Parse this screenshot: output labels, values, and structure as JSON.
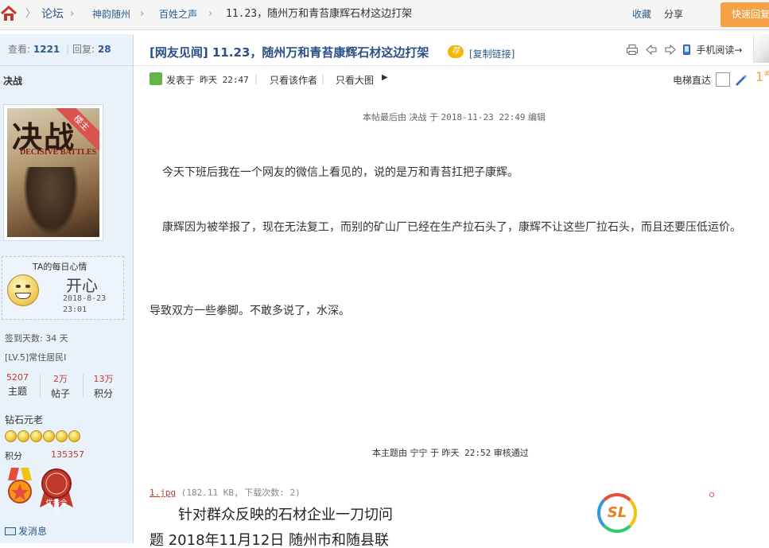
{
  "breadcrumb": {
    "items": [
      "论坛",
      "神韵随州",
      "百姓之声",
      "11.23，随州万和青苔康辉石材这边打架"
    ]
  },
  "top_actions": {
    "favorite": "收藏",
    "share": "分享",
    "quick_reply": "快速回复"
  },
  "sidebar": {
    "view_label": "查看:",
    "view_count": "1221",
    "reply_label": "回复:",
    "reply_count": "28",
    "username": "决战",
    "avatar": {
      "title": "决战",
      "subtitle": "DECISIVE BATTLES",
      "ribbon": "楼主"
    },
    "mood": {
      "label": "TA的每日心情",
      "text": "开心",
      "time": "2018-8-23 23:01"
    },
    "checkin": "签到天数: 34 天",
    "level": "[LV.5]常住居民I",
    "stats": [
      {
        "value": "5207",
        "label": "主题"
      },
      {
        "value": "2万",
        "label": "帖子"
      },
      {
        "value": "13万",
        "label": "积分"
      }
    ],
    "rank": "钻石元老",
    "points_label": "积分",
    "points_value": "135357",
    "medal_text": "优秀会员",
    "send_message": "发消息"
  },
  "post": {
    "title": "[网友见闻] 11.23，随州万和青苔康辉石材这边打架",
    "badge": "荐",
    "copy_link": "[复制链接]",
    "mobile_read": "手机阅读",
    "posted_on": "发表于",
    "posted_time": "昨天 22:47",
    "author_only": "只看该作者",
    "large_image": "只看大图",
    "elevator": "电梯直达",
    "floor": "1",
    "floor_suffix": "#",
    "edited": {
      "prefix": "本帖最后由",
      "user": "决战",
      "at": "于",
      "time": "2018-11-23 22:49",
      "suffix": "编辑"
    },
    "paragraphs": [
      "今天下班后我在一个网友的微信上看见的，说的是万和青苔扛把子康辉。",
      "康辉因为被举报了，现在无法复工，而别的矿山厂已经在生产拉石头了，康辉不让这些厂拉石头，而且还要压低运价。",
      "导致双方一些拳脚。不敢多说了，水深。"
    ],
    "review": {
      "prefix": "本主题由",
      "user": "宁宁",
      "at": "于",
      "time": "昨天 22:52",
      "suffix": "审核通过"
    },
    "attachment": {
      "filename": "1.jpg",
      "info": "(182.11 KB, 下载次数: 2)"
    },
    "image_text": {
      "line1": "针对群众反映的石材企业一刀切问",
      "line2": "题  2018年11月12日  随州市和随县联"
    },
    "logo_text": "SL"
  }
}
